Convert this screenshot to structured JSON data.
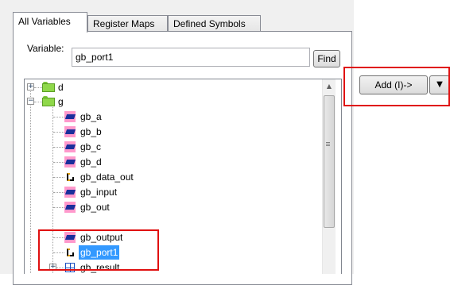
{
  "tabs": [
    {
      "label": "All Variables",
      "active": true
    },
    {
      "label": "Register Maps",
      "active": false
    },
    {
      "label": "Defined Symbols",
      "active": false
    }
  ],
  "variable": {
    "label": "Variable:",
    "value": "gb_port1"
  },
  "find_button": {
    "label": "Find"
  },
  "tree": {
    "folders": [
      {
        "name": "d",
        "expanded": false
      },
      {
        "name": "g",
        "expanded": true
      }
    ],
    "g_children": [
      {
        "name": "gb_a",
        "icon": "variable-icon"
      },
      {
        "name": "gb_b",
        "icon": "variable-icon"
      },
      {
        "name": "gb_c",
        "icon": "variable-icon"
      },
      {
        "name": "gb_d",
        "icon": "variable-icon"
      },
      {
        "name": "gb_data_out",
        "icon": "signal-icon"
      },
      {
        "name": "gb_input",
        "icon": "variable-icon"
      },
      {
        "name": "gb_out",
        "icon": "variable-icon"
      },
      {
        "name": "gb_output",
        "icon": "variable-icon"
      },
      {
        "name": "gb_port1",
        "icon": "signal-icon",
        "selected": true
      },
      {
        "name": "gb_result",
        "icon": "grid-icon",
        "expandable": true
      }
    ]
  },
  "add_button": {
    "label": "Add (I)->"
  },
  "colors": {
    "selection": "#3399ff",
    "highlight_box": "#e01010",
    "variable_icon_bg": "#ff99cc"
  }
}
